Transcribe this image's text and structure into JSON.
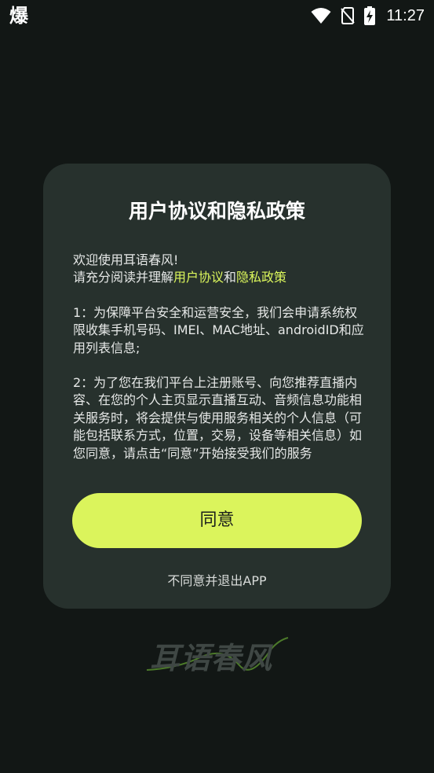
{
  "status_bar": {
    "app_icon_text": "爆",
    "time": "11:27",
    "icons": [
      "wifi-icon",
      "no-sim-icon",
      "battery-charging-icon"
    ]
  },
  "dialog": {
    "title": "用户协议和隐私政策",
    "welcome": "欢迎使用耳语春风!",
    "read_prefix": "请充分阅读并理解",
    "user_agreement_link": "用户协议",
    "and_text": "和",
    "privacy_policy_link": "隐私政策",
    "point1": "1：为保障平台安全和运营安全，我们会申请系统权限收集手机号码、IMEI、MAC地址、androidID和应用列表信息;",
    "point2": "2：为了您在我们平台上注册账号、向您推荐直播内容、在您的个人主页显示直播互动、音频信息功能相关服务时，将会提供与使用服务相关的个人信息（可能包括联系方式，位置，交易，设备等相关信息）如您同意，请点击“同意”开始接受我们的服务",
    "agree_button": "同意",
    "disagree_link": "不同意并退出APP"
  },
  "logo": {
    "text": "耳语春风"
  },
  "colors": {
    "background": "#121715",
    "dialog": "#27312d",
    "accent": "#dbf45c",
    "link": "#dcf75c"
  }
}
